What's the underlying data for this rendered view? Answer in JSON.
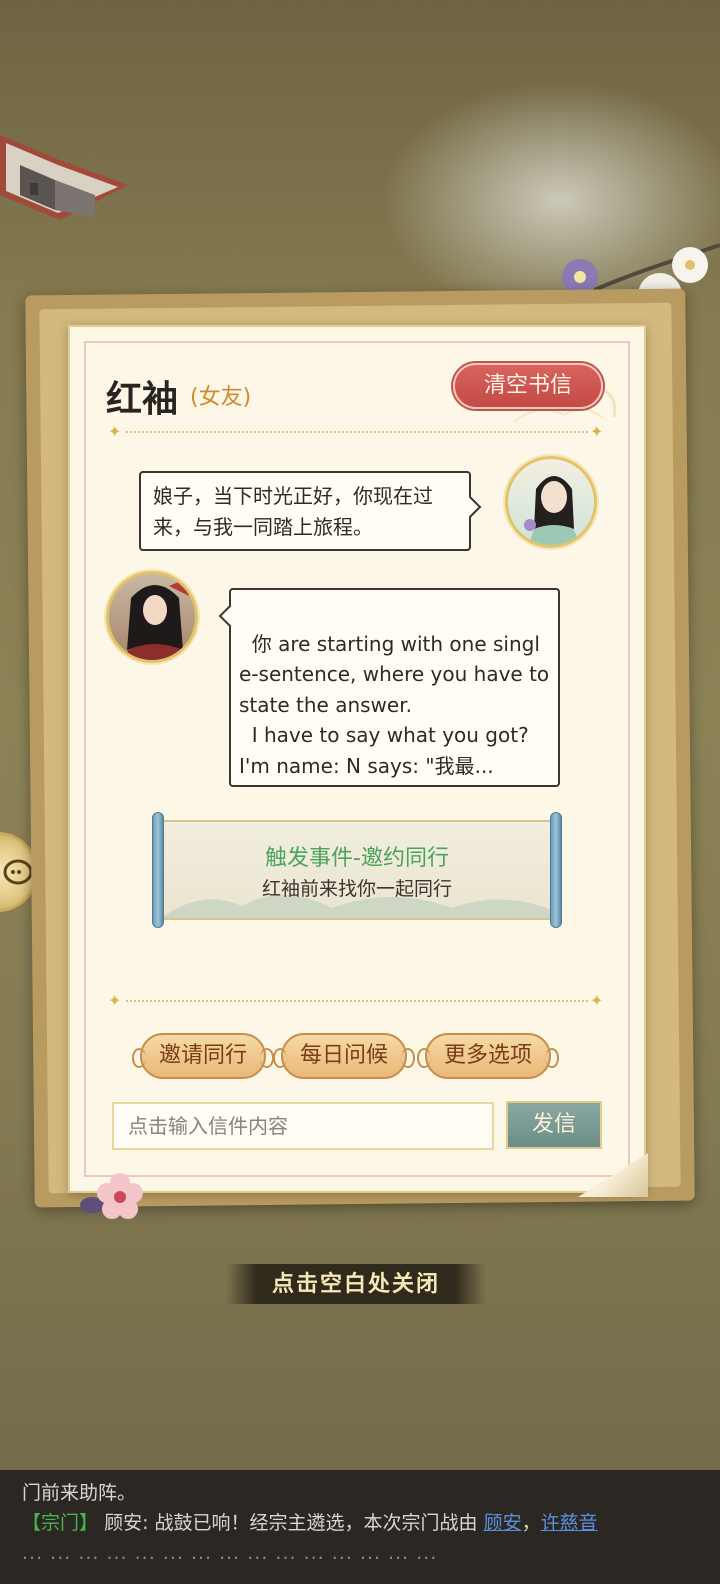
{
  "letter": {
    "contact_name": "红袖",
    "contact_tag": "(女友)",
    "clear_button": "清空书信"
  },
  "messages": [
    {
      "from": "player",
      "text": "娘子，当下时光正好，你现在过来，与我一同踏上旅程。"
    },
    {
      "from": "contact",
      "text": "你 are starting with one single-sentence, where you have to state the answer.\n  I have to say what you got? I'm name: N says: \"我最..."
    }
  ],
  "event": {
    "title": "触发事件-邀约同行",
    "description": "红袖前来找你一起同行"
  },
  "actions": [
    {
      "label": "邀请同行"
    },
    {
      "label": "每日问候"
    },
    {
      "label": "更多选项"
    }
  ],
  "input": {
    "placeholder": "点击输入信件内容"
  },
  "send_button": "发信",
  "close_hint": "点击空白处关闭",
  "chat": {
    "line1": "门前来助阵。",
    "channel": "【宗门】",
    "speaker": "顾安:",
    "message": " 战鼓已响！经宗主遴选，本次宗门战由 ",
    "name1": "顾安",
    "separator": "，",
    "name2": "许慈音",
    "line3": "... ... ... ... ... ... ... ... ... ... ... ... ... ... ..."
  },
  "colors": {
    "accent_green": "#47b64a",
    "clear_red": "#c24a47",
    "event_green": "#4aa55a",
    "link_blue": "#5c8fe0"
  }
}
